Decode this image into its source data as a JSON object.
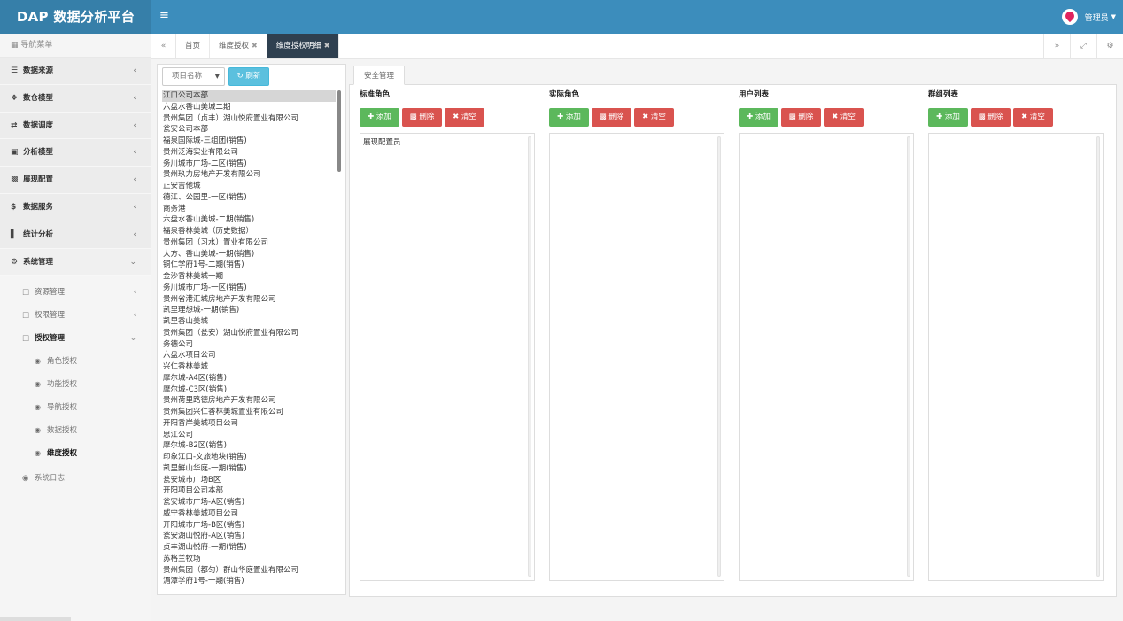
{
  "app": {
    "title": "DAP 数据分析平台",
    "user": "管理员"
  },
  "sidebar": {
    "header": "导航菜单",
    "menu": [
      {
        "label": "数据来源",
        "icon": "database-icon"
      },
      {
        "label": "数仓模型",
        "icon": "cubes-icon"
      },
      {
        "label": "数据调度",
        "icon": "random-icon"
      },
      {
        "label": "分析模型",
        "icon": "analysis-icon"
      },
      {
        "label": "展现配置",
        "icon": "film-icon"
      },
      {
        "label": "数据服务",
        "icon": "dollar-icon"
      },
      {
        "label": "统计分析",
        "icon": "bar-chart-icon"
      },
      {
        "label": "系统管理",
        "icon": "gear-icon"
      }
    ],
    "submenu": [
      {
        "label": "资源管理"
      },
      {
        "label": "权限管理"
      },
      {
        "label": "授权管理"
      }
    ],
    "leaves": [
      {
        "label": "角色授权"
      },
      {
        "label": "功能授权"
      },
      {
        "label": "导航授权"
      },
      {
        "label": "数据授权"
      },
      {
        "label": "维度授权"
      }
    ],
    "log": "系统日志"
  },
  "tabs": [
    {
      "label": "首页"
    },
    {
      "label": "维度授权"
    },
    {
      "label": "维度授权明细"
    }
  ],
  "left_panel": {
    "select_value": "项目名称",
    "refresh_label": "刷新",
    "items": [
      "江口公司本部",
      "六盘水香山美城二期",
      "贵州集团（贞丰）湖山悦府置业有限公司",
      "瓮安公司本部",
      "福泉国际城-三组团(销售)",
      "贵州泛海实业有限公司",
      "务川城市广场-二区(销售)",
      "贵州玖力房地产开发有限公司",
      "正安吉他城",
      "德江、公园里-一区(销售)",
      "商务港",
      "六盘水香山美城-二期(销售)",
      "福泉香林美城（历史数据）",
      "贵州集团（习水）置业有限公司",
      "大方、香山美城-一期(销售)",
      "铜仁学府1号-二期(销售)",
      "金沙香林美城一期",
      "务川城市广场-一区(销售)",
      "贵州省港汇城房地产开发有限公司",
      "凯里理想城-一期(销售)",
      "凯里香山美城",
      "贵州集团（瓮安）湖山悦府置业有限公司",
      "务德公司",
      "六盘水项目公司",
      "兴仁香林美城",
      "摩尔城-A4区(销售)",
      "摩尔城-C3区(销售)",
      "贵州荷里路德房地产开发有限公司",
      "贵州集团兴仁香林美城置业有限公司",
      "开阳香岸美城项目公司",
      "思江公司",
      "摩尔城-B2区(销售)",
      "印象江口-文旅地块(销售)",
      "凯里鲜山华庭-一期(销售)",
      "瓮安城市广场B区",
      "开阳项目公司本部",
      "瓮安城市广场-A区(销售)",
      "威宁香林美城项目公司",
      "开阳城市广场-B区(销售)",
      "瓮安湖山悦府-A区(销售)",
      "贞丰湖山悦府-一期(销售)",
      "苏格兰牧场",
      "贵州集团（都匀）群山华庭置业有限公司",
      "湄潭学府1号-一期(销售)"
    ]
  },
  "security": {
    "tab_label": "安全管理",
    "add_label": "添加",
    "delete_label": "删除",
    "clear_label": "清空",
    "groups": [
      {
        "title": "标准角色",
        "entries": [
          "展现配置员"
        ]
      },
      {
        "title": "实际角色",
        "entries": []
      },
      {
        "title": "用户列表",
        "entries": []
      },
      {
        "title": "群组列表",
        "entries": []
      }
    ]
  }
}
